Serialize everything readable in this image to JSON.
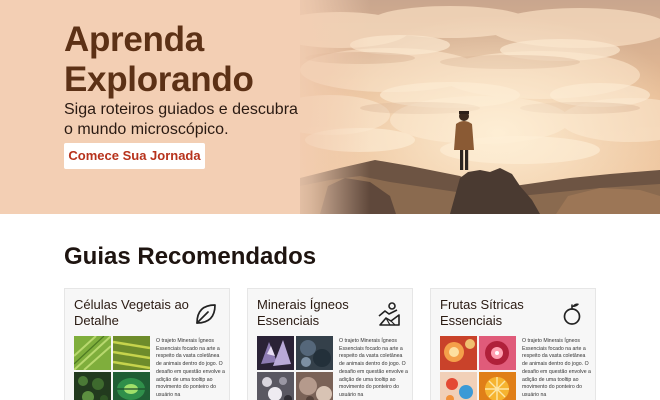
{
  "hero": {
    "title": "Aprenda Explorando",
    "subtitle": "Siga roteiros guiados e descubra o mundo microscópico.",
    "cta_label": "Comece Sua Jornada",
    "background_color": "#f3cfb4",
    "title_color": "#5c3116",
    "cta_text_color": "#b7321c"
  },
  "section": {
    "title": "Guias Recomendados"
  },
  "cards": [
    {
      "title": "Células Vegetais ao Detalhe",
      "icon": "leaf-icon",
      "description": "O trajeto Minerais Ígneos Essenciais focado na arte a respeito da vasta coletânea de animais dentro do jogo. O desafio em questão envolve a adição de uma tooltip ao movimento do ponteiro do usuário na"
    },
    {
      "title": "Minerais Ígneos Essenciais",
      "icon": "minerals-icon",
      "description": "O trajeto Minerais Ígneos Essenciais focado na arte a respeito da vasta coletânea de animais dentro do jogo. O desafio em questão envolve a adição de uma tooltip ao movimento do ponteiro do usuário na"
    },
    {
      "title": "Frutas Sítricas Essenciais",
      "icon": "fruit-icon",
      "description": "O trajeto Minerais Ígneos Essenciais focado na arte a respeito da vasta coletânea de animais dentro do jogo. O desafio em questão envolve a adição de uma tooltip ao movimento do ponteiro do usuário na"
    }
  ]
}
